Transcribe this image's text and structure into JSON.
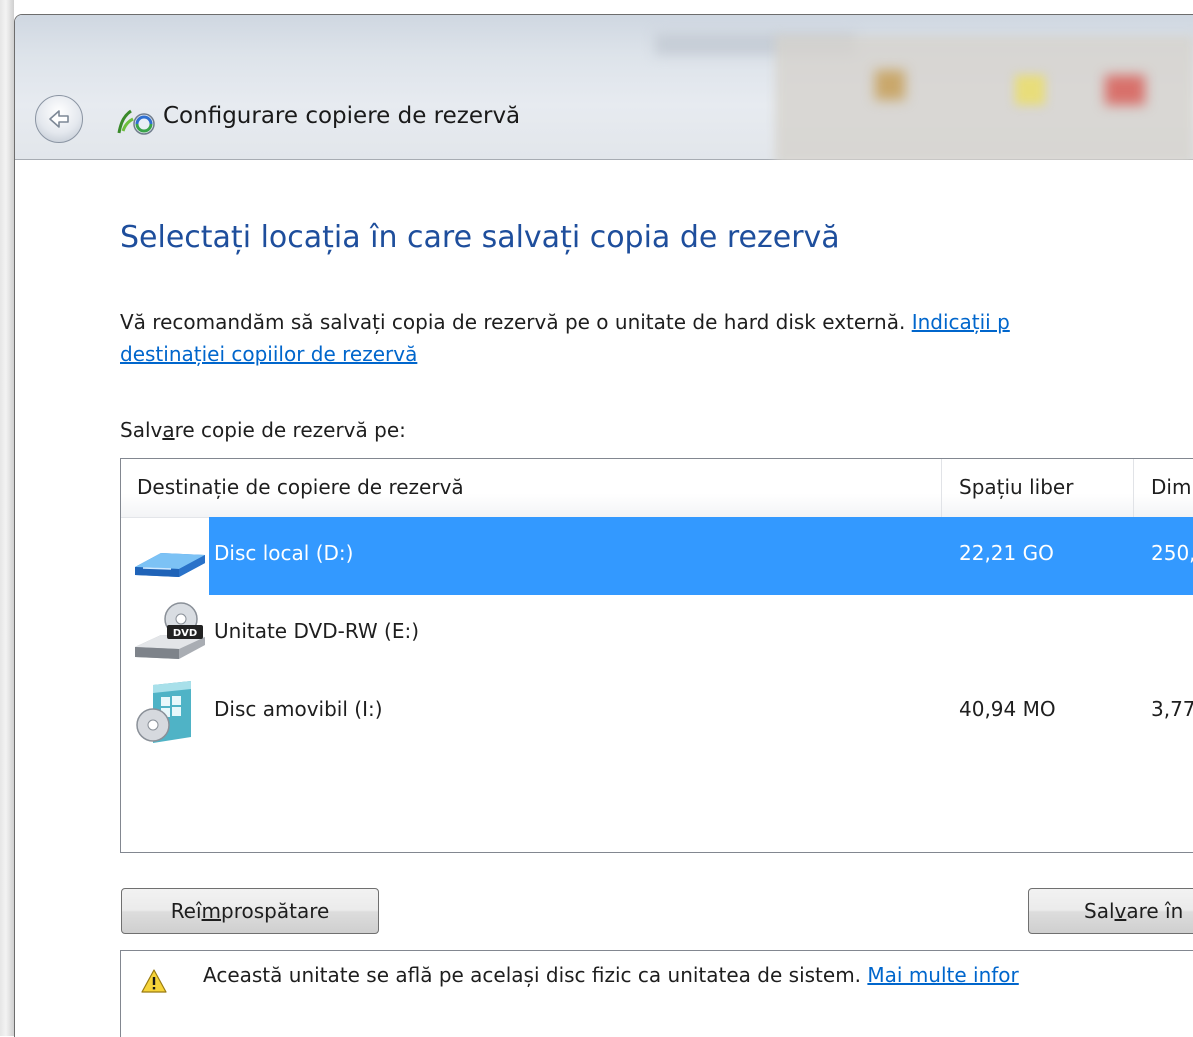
{
  "window": {
    "title": "Configurare copiere de rezervă"
  },
  "page": {
    "heading": "Selectați locația în care salvați copia de rezervă",
    "description_line1": "Vă recomandăm să salvați copia de rezervă pe o unitate de hard disk externă. ",
    "description_link_part1": "Indicații p",
    "description_link_part2": "destinației copiilor de rezervă",
    "save_label_pre": "Salv",
    "save_label_mnemonic": "a",
    "save_label_post": "re copie de rezervă pe:"
  },
  "list": {
    "columns": [
      "Destinație de copiere de rezervă",
      "Spațiu liber",
      "Dim"
    ],
    "rows": [
      {
        "name": "Disc local (D:)",
        "free": "22,21 GO",
        "size": "250,",
        "icon": "hard-drive-icon",
        "selected": true
      },
      {
        "name": "Unitate DVD-RW (E:)",
        "free": "",
        "size": "",
        "icon": "dvd-drive-icon",
        "selected": false
      },
      {
        "name": "Disc amovibil (I:)",
        "free": "40,94 MO",
        "size": "3,77",
        "icon": "removable-disk-icon",
        "selected": false
      }
    ]
  },
  "buttons": {
    "refresh_pre": "Reî",
    "refresh_mnemonic": "m",
    "refresh_post": "prospătare",
    "save_pre": "Sal",
    "save_mnemonic": "v",
    "save_post": "are în"
  },
  "info": {
    "text": "Această unitate se află pe același disc fizic ca unitatea de sistem. ",
    "link": "Mai multe infor"
  },
  "colors": {
    "heading": "#1e4e9c",
    "link": "#0066cc",
    "selection": "#3399ff"
  }
}
